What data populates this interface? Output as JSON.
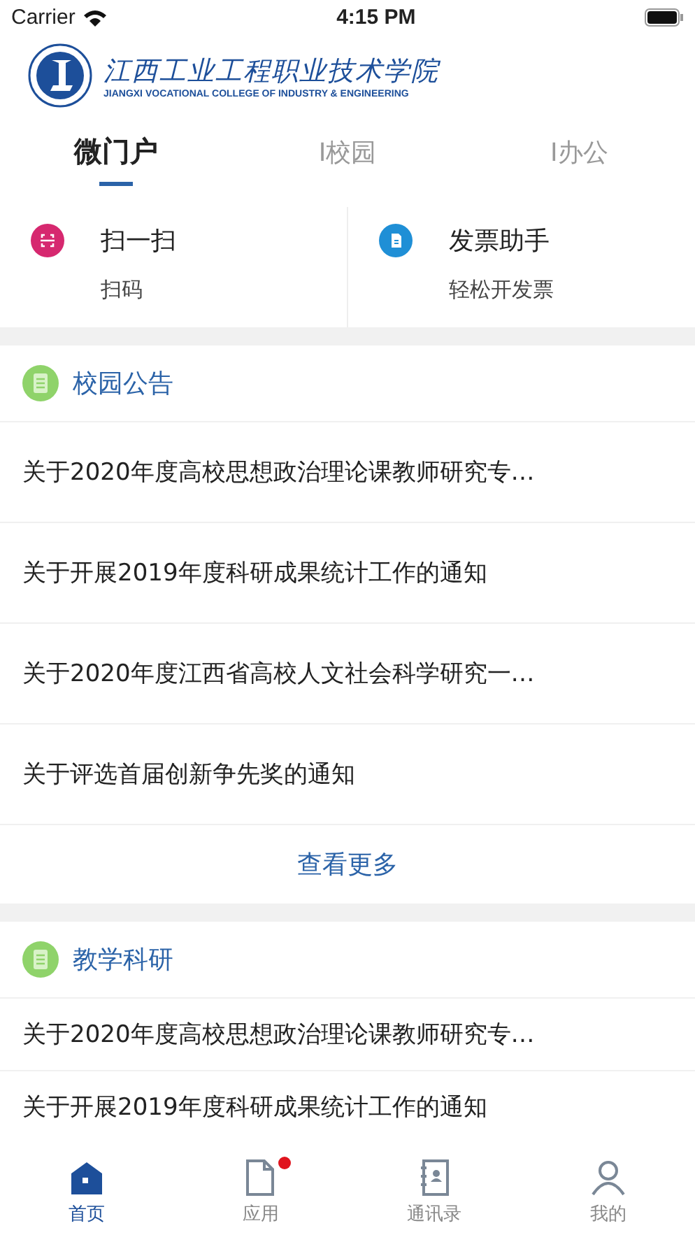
{
  "status_bar": {
    "carrier": "Carrier",
    "time": "4:15 PM"
  },
  "header": {
    "school_name": "江西工业工程职业技术学院",
    "school_name_en": "JIANGXI VOCATIONAL COLLEGE OF INDUSTRY & ENGINEERING"
  },
  "tabs": [
    {
      "label": "微门户",
      "selected": true
    },
    {
      "label": "I校园",
      "selected": false
    },
    {
      "label": "I办公",
      "selected": false
    }
  ],
  "quick_actions": [
    {
      "kind": "scan",
      "title": "扫一扫",
      "subtitle": "扫码",
      "color": "#d6286f"
    },
    {
      "kind": "invoice",
      "title": "发票助手",
      "subtitle": "轻松开发票",
      "color": "#1f8fd6"
    }
  ],
  "sections": [
    {
      "title": "校园公告",
      "items": [
        "关于2020年度高校思想政治理论课教师研究专…",
        "关于开展2019年度科研成果统计工作的通知",
        "关于2020年度江西省高校人文社会科学研究一…",
        "关于评选首届创新争先奖的通知"
      ],
      "more": "查看更多"
    },
    {
      "title": "教学科研",
      "items": [
        "关于2020年度高校思想政治理论课教师研究专…",
        "关于开展2019年度科研成果统计工作的通知"
      ]
    }
  ],
  "tab_bar": [
    {
      "kind": "home",
      "label": "首页",
      "selected": true,
      "badge": false
    },
    {
      "kind": "apps",
      "label": "应用",
      "selected": false,
      "badge": true
    },
    {
      "kind": "contacts",
      "label": "通讯录",
      "selected": false,
      "badge": false
    },
    {
      "kind": "profile",
      "label": "我的",
      "selected": false,
      "badge": false
    }
  ]
}
